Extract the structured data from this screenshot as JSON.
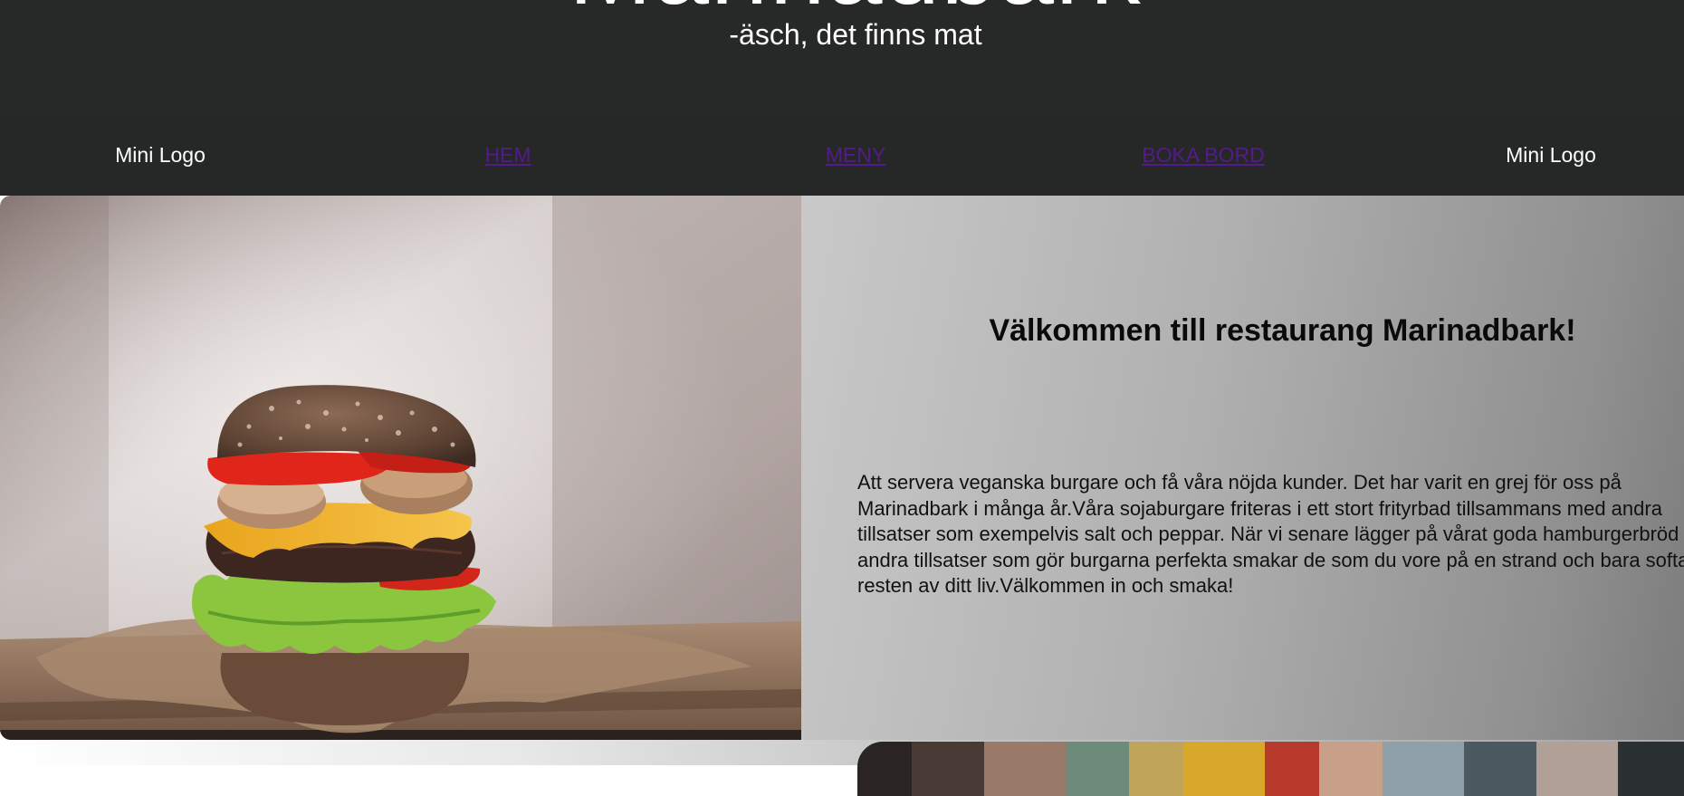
{
  "header": {
    "title": "Marinadbark",
    "tagline": "-äsch, det finns mat"
  },
  "nav": {
    "mini_logo_left": "Mini Logo",
    "home": "HEM",
    "menu": "MENY",
    "book": "BOKA BORD",
    "mini_logo_right": "Mini Logo"
  },
  "hero": {
    "image_icon": "burger-photo",
    "title": "Välkommen till restaurang Marinadbark!",
    "text": "Att servera veganska burgare och få våra nöjda kunder. Det har varit en grej för oss på\nMarinadbark i många år.Våra sojaburgare friteras i ett stort frityrbad tillsammans med andra\ntillsatser som exempelvis salt och peppar. När vi senare lägger på vårat goda hamburgerbröd och\nandra tillsatser som gör burgarna perfekta smakar de som du vore på en strand och bara softar\nresten av ditt liv.Välkommen in och smaka!"
  },
  "colors": {
    "header_bg": "#272929",
    "nav_bg": "#262828",
    "link": "#551a8b",
    "panel_gradient_start": "#c9c9c9",
    "panel_gradient_end": "#7c7c7c"
  }
}
